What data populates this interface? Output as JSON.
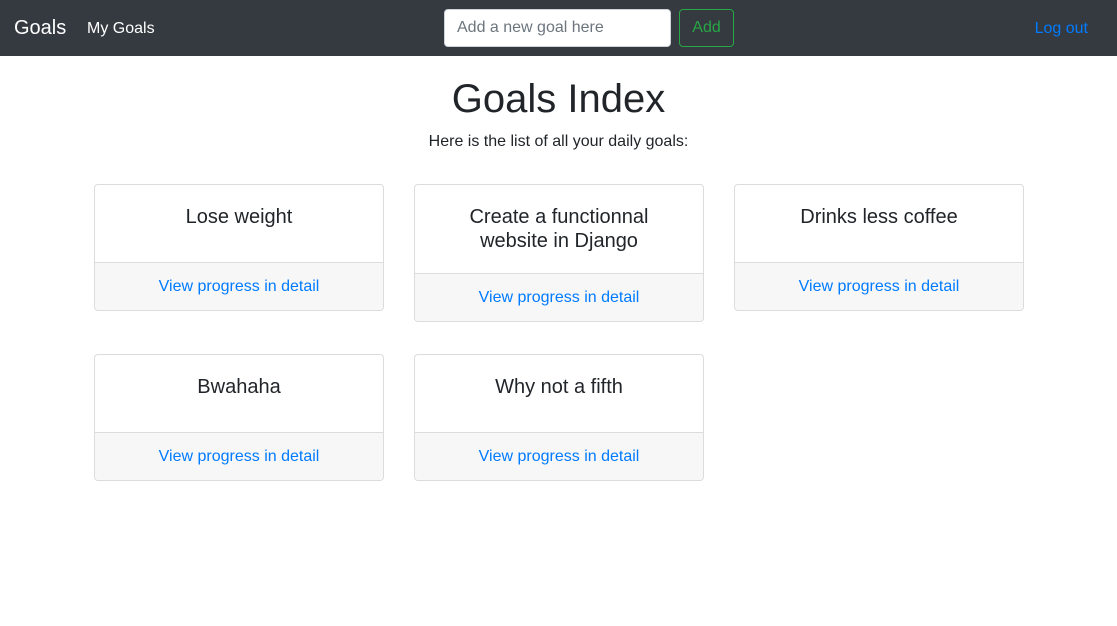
{
  "navbar": {
    "brand": "Goals",
    "my_goals_link": "My Goals",
    "goal_input_placeholder": "Add a new goal here",
    "add_button": "Add",
    "logout_link": "Log out"
  },
  "main": {
    "title": "Goals Index",
    "subtitle": "Here is the list of all your daily goals:"
  },
  "goals": [
    {
      "title": "Lose weight",
      "link": "View progress in detail"
    },
    {
      "title": "Create a functionnal website in Django",
      "link": "View progress in detail"
    },
    {
      "title": "Drinks less coffee",
      "link": "View progress in detail"
    },
    {
      "title": "Bwahaha",
      "link": "View progress in detail"
    },
    {
      "title": "Why not a fifth",
      "link": "View progress in detail"
    }
  ],
  "colors": {
    "navbar_bg": "#343a40",
    "link_blue": "#007bff",
    "success_green": "#28a745"
  }
}
